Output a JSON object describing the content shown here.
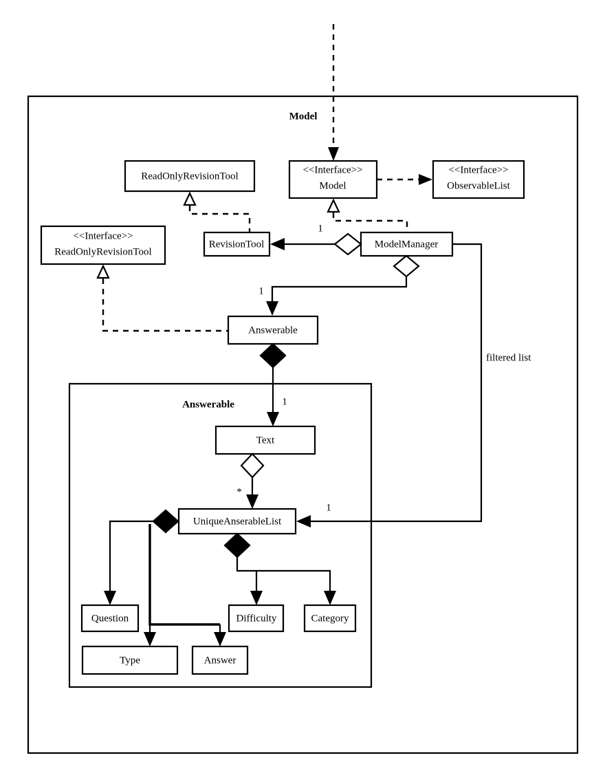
{
  "diagram": {
    "title": "Model",
    "packages": [
      {
        "id": "model-package",
        "label": "Model"
      },
      {
        "id": "answerable-package",
        "label": "Answerable"
      }
    ],
    "classes": [
      {
        "id": "read-only-revision-tool-class",
        "name": "ReadOnlyRevisionTool",
        "stereotype": ""
      },
      {
        "id": "model-interface",
        "name": "Model",
        "stereotype": "<<Interface>>"
      },
      {
        "id": "observable-list-interface",
        "name": "ObservableList",
        "stereotype": "<<Interface>>"
      },
      {
        "id": "read-only-revision-tool-interface",
        "name": "ReadOnlyRevisionTool",
        "stereotype": "<<Interface>>"
      },
      {
        "id": "revision-tool-class",
        "name": "RevisionTool",
        "stereotype": ""
      },
      {
        "id": "model-manager-class",
        "name": "ModelManager",
        "stereotype": ""
      },
      {
        "id": "answerable-class",
        "name": "Answerable",
        "stereotype": ""
      },
      {
        "id": "text-class",
        "name": "Text",
        "stereotype": ""
      },
      {
        "id": "unique-anserable-list-class",
        "name": "UniqueAnserableList",
        "stereotype": ""
      },
      {
        "id": "question-class",
        "name": "Question",
        "stereotype": ""
      },
      {
        "id": "type-class",
        "name": "Type",
        "stereotype": ""
      },
      {
        "id": "answer-class",
        "name": "Answer",
        "stereotype": ""
      },
      {
        "id": "difficulty-class",
        "name": "Difficulty",
        "stereotype": ""
      },
      {
        "id": "category-class",
        "name": "Category",
        "stereotype": ""
      }
    ],
    "multiplicities": {
      "model_manager_to_revision_tool": "1",
      "model_manager_to_answerable": "1",
      "answerable_to_text": "1",
      "text_to_unique_list": "*",
      "model_manager_to_unique_list": "1"
    },
    "annotations": {
      "filtered_list": "filtered list"
    },
    "colors": {
      "stroke": "#000000",
      "fill": "#ffffff",
      "background": "#ffffff"
    }
  }
}
